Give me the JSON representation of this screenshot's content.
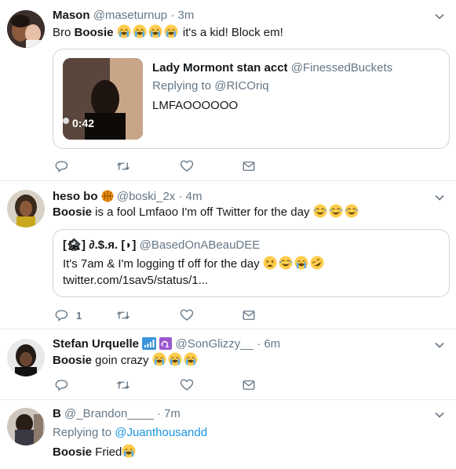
{
  "tweets": [
    {
      "name": "Mason",
      "handle": "@maseturnup",
      "dot": "·",
      "time": "3m",
      "text_before": "Bro ",
      "bold_word": "Boosie",
      "text_after": " it's a kid! Block em!",
      "quote": {
        "name": "Lady Mormont stan acct",
        "handle": "@FinessedBuckets",
        "reply_prefix": "Replying to ",
        "reply_link": "@RICOriq",
        "text": "LMFAOOOOOO",
        "video_duration": "0:42"
      },
      "replies": "",
      "icons": [
        "reply-icon",
        "retweet-icon",
        "like-icon",
        "message-icon"
      ]
    },
    {
      "name": "heso bo",
      "handle": "@boski_2x",
      "dot": "·",
      "time": "4m",
      "bold_word": "Boosie",
      "text_after": " is a fool Lmfaoo I'm off Twitter for the day ",
      "quote": {
        "name": "[🏚] ∂.$.я. [◗]",
        "handle": "@BasedOnABeauDEE",
        "text": "It's 7am & I'm logging tf off for the day ",
        "link": "twitter.com/1sav5/status/1..."
      },
      "replies": "1"
    },
    {
      "name": "Stefan Urquelle",
      "handle": "@SonGlizzy__",
      "dot": "·",
      "time": "6m",
      "bold_word": "Boosie",
      "text_after": " goin crazy "
    },
    {
      "name": "B",
      "handle": "@_Brandon____",
      "dot": "·",
      "time": "7m",
      "reply_prefix": "Replying to ",
      "reply_link": "@Juanthousandd",
      "bold_word": "Boosie",
      "text_after": " Fried"
    }
  ],
  "colors": {
    "text": "#14171a",
    "secondary": "#657786",
    "link": "#1b95e0",
    "border": "#e6ecf0",
    "emoji": "#ffcc4d"
  }
}
